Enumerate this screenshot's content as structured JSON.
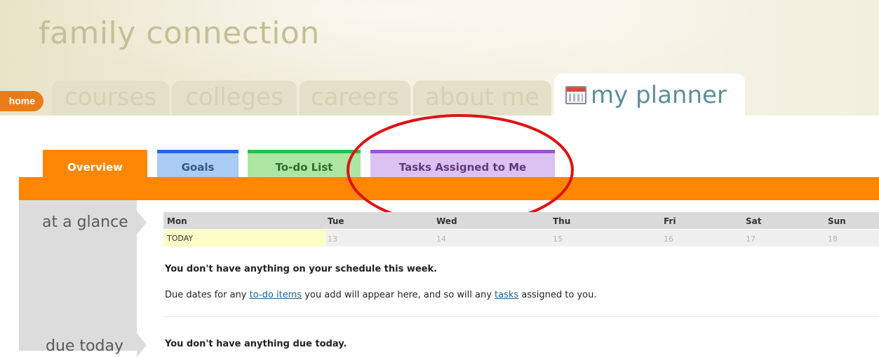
{
  "app": {
    "title": "family connection"
  },
  "nav": {
    "home": "home",
    "tabs": [
      {
        "label": "courses"
      },
      {
        "label": "colleges"
      },
      {
        "label": "careers"
      },
      {
        "label": "about me"
      },
      {
        "label": "my planner",
        "icon": "calendar-icon",
        "active": true
      }
    ]
  },
  "subtabs": [
    {
      "label": "Overview",
      "color": "#fd8602",
      "text_color": "#ffffff",
      "active": true
    },
    {
      "label": "Goals",
      "color": "#2866e8",
      "bg": "#aaccf4",
      "text_color": "#2f5a8a"
    },
    {
      "label": "To-do List",
      "color": "#22c24a",
      "bg": "#ace6a2",
      "text_color": "#2d6b30"
    },
    {
      "label": "Tasks Assigned to Me",
      "color": "#9a55d6",
      "bg": "#dcc2f2",
      "text_color": "#5d3c7a"
    }
  ],
  "annotation": {
    "color": "#e01212"
  },
  "sections": {
    "at_a_glance": "at a glance",
    "due_today": "due today"
  },
  "calendar": {
    "days": [
      "Mon",
      "Tue",
      "Wed",
      "Thu",
      "Fri",
      "Sat",
      "Sun"
    ],
    "dates": [
      "TODAY",
      "13",
      "14",
      "15",
      "16",
      "17",
      "18"
    ],
    "empty_week": "You don't have anything on your schedule this week.",
    "info_prefix": "Due dates for any ",
    "info_link1": "to-do items",
    "info_middle": " you add will appear here, and so will any ",
    "info_link2": "tasks",
    "info_suffix": " assigned to you."
  },
  "due_today": {
    "empty": "You don't have anything due today."
  }
}
